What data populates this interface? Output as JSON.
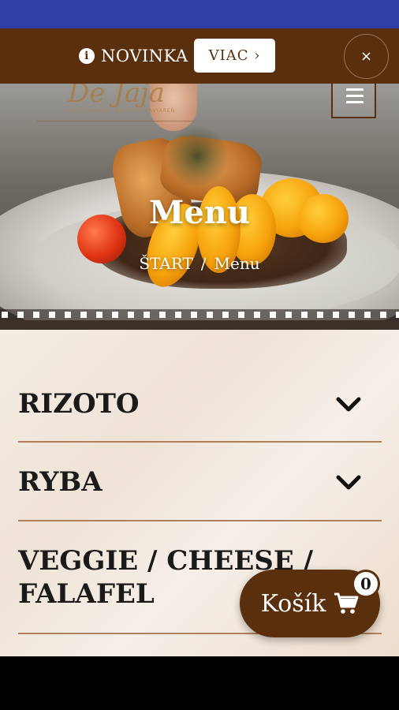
{
  "notice": {
    "label": "NOVINKA",
    "more_label": "VIAC ›",
    "close_label": "×"
  },
  "logo": {
    "text": "De Jaja",
    "tagline": "REŠTAURÁCIA · BISTRO · KAVIAREŇ"
  },
  "hero": {
    "title": "Menu",
    "breadcrumb": [
      "ŠTART",
      "/",
      "Menu"
    ]
  },
  "categories": [
    {
      "label": "RIZOTO"
    },
    {
      "label": "RYBA"
    },
    {
      "label": "VEGGIE / CHEESE / FALAFEL"
    }
  ],
  "cart": {
    "label": "Košík",
    "count": "0"
  },
  "colors": {
    "brand_brown": "#5a2f0d",
    "status_blue": "#2f3fa5"
  }
}
